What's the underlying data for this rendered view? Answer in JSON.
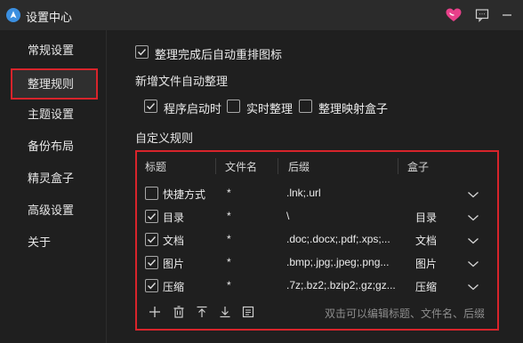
{
  "window": {
    "title": "设置中心",
    "icons": [
      "app-logo-icon",
      "heart-icon",
      "feedback-icon",
      "minimize-icon"
    ],
    "accent_heart": "#e8408a"
  },
  "sidebar": {
    "items": [
      {
        "label": "常规设置"
      },
      {
        "label": "整理规则",
        "active": true
      },
      {
        "label": "主题设置"
      },
      {
        "label": "备份布局"
      },
      {
        "label": "精灵盒子"
      },
      {
        "label": "高级设置"
      },
      {
        "label": "关于"
      }
    ]
  },
  "main": {
    "auto_sort_icons": {
      "label": "整理完成后自动重排图标",
      "checked": true
    },
    "new_file_section": "新增文件自动整理",
    "options": [
      {
        "label": "程序启动时",
        "checked": true
      },
      {
        "label": "实时整理",
        "checked": false
      },
      {
        "label": "整理映射盒子",
        "checked": false
      }
    ],
    "rules_section": "自定义规则",
    "table": {
      "columns": [
        "标题",
        "文件名",
        "后缀",
        "盒子"
      ],
      "rows": [
        {
          "checked": false,
          "title": "快捷方式",
          "filename": "*",
          "suffix": ".lnk;.url",
          "box": ""
        },
        {
          "checked": true,
          "title": "目录",
          "filename": "*",
          "suffix": "\\",
          "box": "目录"
        },
        {
          "checked": true,
          "title": "文档",
          "filename": "*",
          "suffix": ".doc;.docx;.pdf;.xps;...",
          "box": "文档"
        },
        {
          "checked": true,
          "title": "图片",
          "filename": "*",
          "suffix": ".bmp;.jpg;.jpeg;.png...",
          "box": "图片"
        },
        {
          "checked": true,
          "title": "压缩",
          "filename": "*",
          "suffix": ".7z;.bz2;.bzip2;.gz;gz...",
          "box": "压缩"
        }
      ]
    },
    "toolbar_icons": [
      "add-icon",
      "delete-icon",
      "move-up-icon",
      "move-down-icon",
      "edit-icon"
    ],
    "hint": "双击可以编辑标题、文件名、后缀",
    "highlight_color": "#d8242b"
  }
}
